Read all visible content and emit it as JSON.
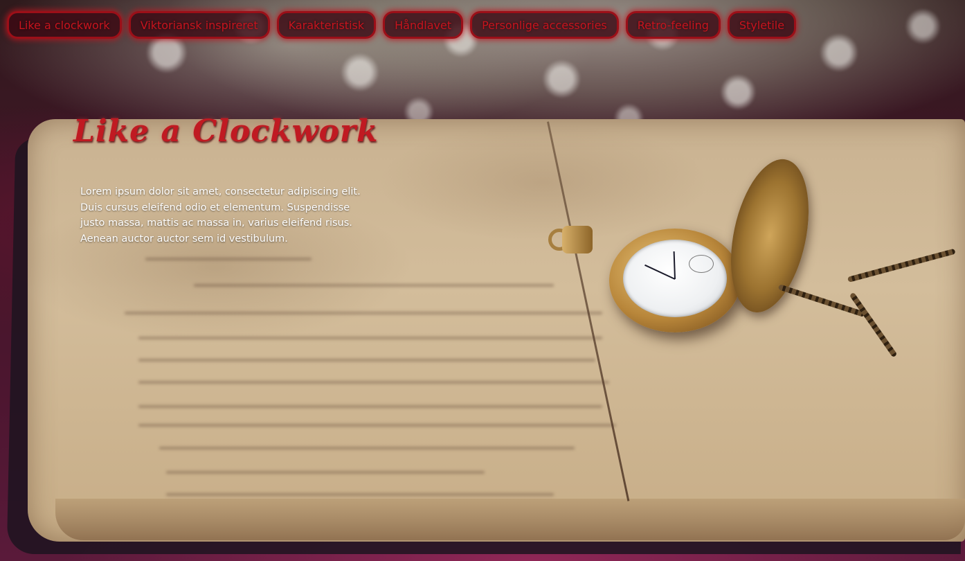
{
  "nav": {
    "items": [
      {
        "label": "Like a clockwork"
      },
      {
        "label": "Viktoriansk inspireret"
      },
      {
        "label": "Karakteristisk"
      },
      {
        "label": "Håndlavet"
      },
      {
        "label": "Personlige accessories"
      },
      {
        "label": "Retro-feeling"
      },
      {
        "label": "Styletile"
      }
    ]
  },
  "hero": {
    "title": "Like a Clockwork",
    "body": "Lorem ipsum dolor sit amet, consectetur adipiscing elit. Duis cursus eleifend odio et elementum. Suspendisse justo massa, mattis ac massa in, varius eleifend risus. Aenean auctor auctor sem id vestibulum."
  },
  "theme": {
    "accent": "#c01a22",
    "nav_bg": "#3c0812",
    "nav_border": "#9c0f18",
    "text_light": "#ffffff"
  },
  "background": {
    "icon": "pocket-watch-on-open-book-image"
  }
}
